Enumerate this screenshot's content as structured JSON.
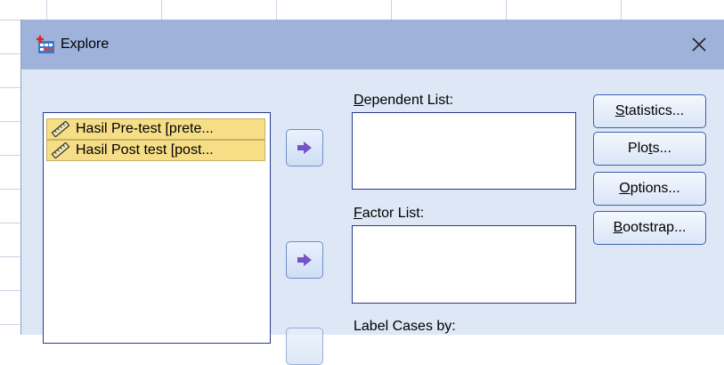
{
  "dialog": {
    "title": "Explore",
    "close_label": "×"
  },
  "source_list": {
    "items": [
      {
        "label": "Hasil Pre-test [prete...",
        "icon": "ruler-icon"
      },
      {
        "label": "Hasil Post test [post...",
        "icon": "ruler-icon"
      }
    ]
  },
  "dependent_list": {
    "label_first": "D",
    "label_rest": "ependent List:"
  },
  "factor_list": {
    "label_first": "F",
    "label_rest": "actor List:"
  },
  "label_cases": {
    "label": "Label Cases by:"
  },
  "buttons": {
    "statistics": {
      "first": "S",
      "rest": "tatistics..."
    },
    "plots": {
      "pre": "Plo",
      "u": "t",
      "post": "s..."
    },
    "options": {
      "first": "O",
      "rest": "ptions..."
    },
    "bootstrap": {
      "first": "B",
      "rest": "ootstrap..."
    }
  },
  "colors": {
    "titlebar": "#9fb3da",
    "dialog_bg": "#dde7f5",
    "selection": "#f6de87",
    "arrow": "#7a52c8"
  }
}
